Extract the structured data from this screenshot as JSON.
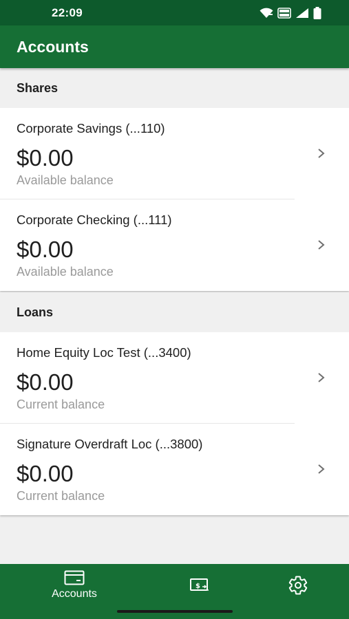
{
  "status_bar": {
    "time": "22:09",
    "icons": [
      "wifi-icon",
      "volte-icon",
      "signal-icon",
      "battery-icon"
    ],
    "volte_text": "VoLTE"
  },
  "app_bar": {
    "title": "Accounts"
  },
  "sections": [
    {
      "title": "Shares",
      "accounts": [
        {
          "name": "Corporate Savings (...110)",
          "amount": "$0.00",
          "label": "Available balance"
        },
        {
          "name": "Corporate Checking (...111)",
          "amount": "$0.00",
          "label": "Available balance"
        }
      ]
    },
    {
      "title": "Loans",
      "accounts": [
        {
          "name": "Home Equity Loc Test (...3400)",
          "amount": "$0.00",
          "label": "Current balance"
        },
        {
          "name": "Signature Overdraft Loc (...3800)",
          "amount": "$0.00",
          "label": "Current balance"
        }
      ]
    }
  ],
  "bottom_nav": {
    "accounts_label": "Accounts",
    "items": [
      "card-icon",
      "money-transfer-icon",
      "gear-icon"
    ]
  },
  "colors": {
    "status_bar": "#0d5a2c",
    "brand_green": "#166f35",
    "background": "#f0f0f0",
    "secondary_text": "#9a9a9a"
  }
}
